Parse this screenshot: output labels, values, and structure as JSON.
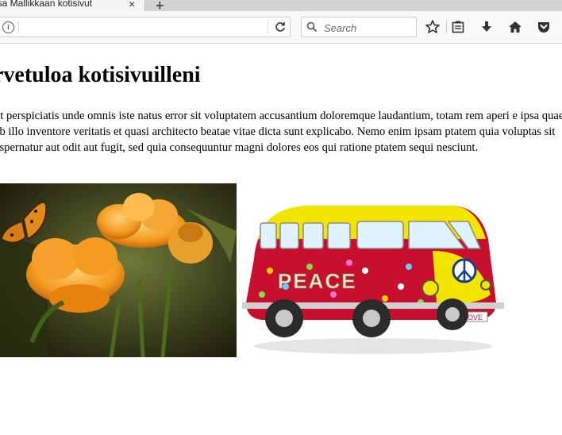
{
  "browser": {
    "tab_title": "isa Mallikkaan kotisivut",
    "tab_close_glyph": "×",
    "new_tab_glyph": "+",
    "url_value": "",
    "search_placeholder": "Search",
    "info_glyph": "i"
  },
  "icons": {
    "info": "info-icon",
    "reload": "reload-icon",
    "search": "search-icon",
    "bookmark": "star-icon",
    "reading_list": "clipboard-icon",
    "downloads": "download-icon",
    "home": "home-icon",
    "pocket": "pocket-icon"
  },
  "page": {
    "heading": "rvetuloa kotisivuilleni",
    "paragraph": "ut perspiciatis unde omnis iste natus error sit voluptatem accusantium doloremque laudantium, totam rem aperi e ipsa quae ab illo inventore veritatis et quasi architecto beatae vitae dicta sunt explicabo. Nemo enim ipsam ptatem quia voluptas sit aspernatur aut odit aut fugit, sed quia consequuntur magni dolores eos qui ratione ptatem sequi nesciunt.",
    "van_text": "PEACE",
    "plate_text": "LOVE"
  },
  "colors": {
    "van_body": "#c8102e",
    "van_top": "#f2e600",
    "flower": "#f39a1e"
  }
}
